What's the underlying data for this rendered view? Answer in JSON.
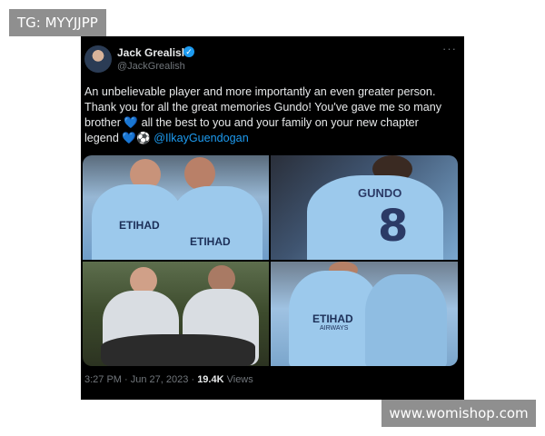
{
  "watermarks": {
    "top_left": "TG: MYYJJPP",
    "bottom_right": "www.womishop.com"
  },
  "tweet": {
    "author_name": "Jack Grealish",
    "author_handle": "@JackGrealish",
    "verified_icon": "verified-badge-icon",
    "more_icon": "more-options-icon",
    "more_label": "···",
    "text_lines": [
      "An unbelievable player and more importantly an even greater person.",
      "Thank you for all the great memories Gundo! You've gave me so many",
      "brother 💙 all the best to you and your family on your new chapter",
      "legend 💙⚽ "
    ],
    "mention": "@IlkayGuendogan",
    "time": "3:27 PM",
    "separator": "·",
    "date": "Jun 27, 2023",
    "views_count": "19.4K",
    "views_label": "Views",
    "photo_texts": {
      "shirt_sponsor": "ETIHAD",
      "shirt_sponsor_sub": "AIRWAYS",
      "back_name": "GUNDO",
      "back_number": "8"
    }
  },
  "colors": {
    "background": "#000000",
    "text": "#e7e9ea",
    "muted": "#71767b",
    "link": "#1d9bf0",
    "city_blue": "#9cc9ec"
  }
}
